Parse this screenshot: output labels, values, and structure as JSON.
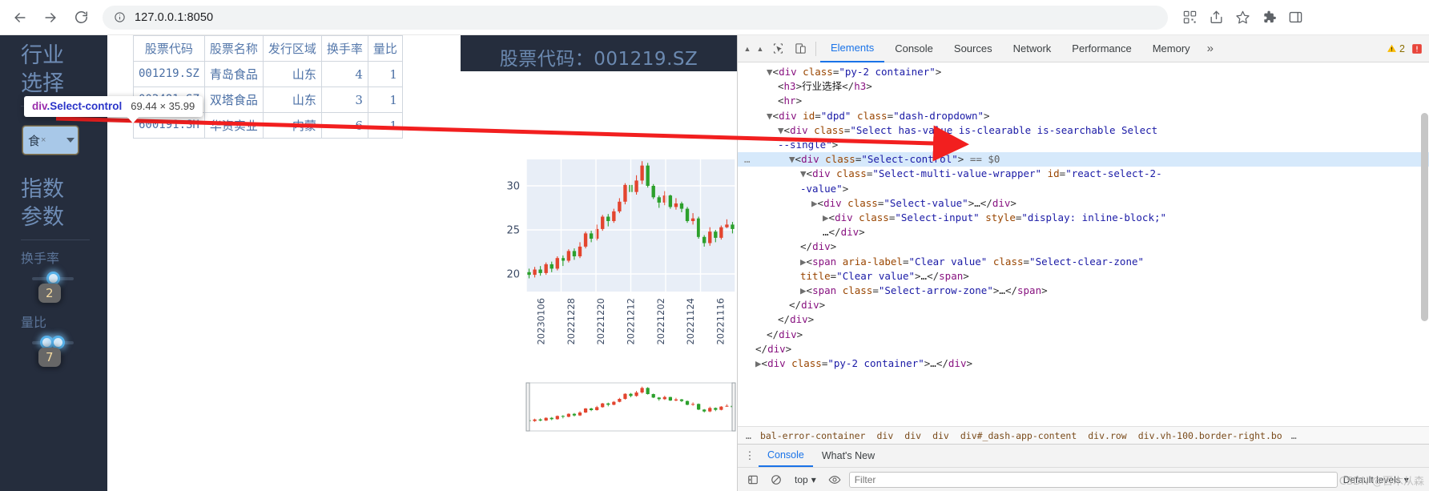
{
  "browser": {
    "url": "127.0.0.1:8050",
    "back_label": "Back",
    "forward_label": "Forward",
    "reload_label": "Reload",
    "site_info_label": "View site information",
    "qr_label": "Create QR code",
    "share_label": "Share this page",
    "bookmark_label": "Bookmark this tab",
    "extensions_label": "Extensions",
    "sidepanel_label": "Side panel"
  },
  "sidebar": {
    "heading_line1": "行业",
    "heading_line2": "选择",
    "dropdown": {
      "value": "食",
      "clear": "×",
      "arrow": "▼"
    },
    "params_line1": "指数",
    "params_line2": "参数",
    "sliders": [
      {
        "label": "换手率",
        "value": "2",
        "pct": 44
      },
      {
        "label": "量比",
        "value": "7",
        "pct": 40
      }
    ]
  },
  "inspect_tooltip": {
    "tag": "div",
    "class": ".Select-control",
    "dimensions": "69.44 × 35.99"
  },
  "table": {
    "columns": [
      "股票代码",
      "股票名称",
      "发行区域",
      "换手率",
      "量比"
    ],
    "rows": [
      [
        "001219.SZ",
        "青岛食品",
        "山东",
        "4",
        "1"
      ],
      [
        "002481.SZ",
        "双塔食品",
        "山东",
        "3",
        "1"
      ],
      [
        "600191.SH",
        "华资实业",
        "内蒙",
        "6",
        "1"
      ]
    ]
  },
  "stock_panel": {
    "title": "股票代码：001219.SZ"
  },
  "chart_data": {
    "type": "candlestick",
    "title": "股票代码：001219.SZ",
    "ylabel": "",
    "xlabel": "",
    "ylim": [
      18,
      33
    ],
    "yticks": [
      20,
      25,
      30
    ],
    "xticks": [
      "20230106",
      "20221228",
      "20221220",
      "20221212",
      "20221202",
      "20221124",
      "20221116"
    ],
    "grid": true,
    "up_color": "#2ca02c",
    "down_color": "#e3452f",
    "series": [
      {
        "date": "20221116",
        "open": 25.1,
        "high": 25.9,
        "low": 24.6,
        "close": 25.6
      },
      {
        "date": "20221117",
        "open": 25.6,
        "high": 26.2,
        "low": 25.2,
        "close": 25.3
      },
      {
        "date": "20221118",
        "open": 25.3,
        "high": 25.5,
        "low": 23.9,
        "close": 24.1
      },
      {
        "date": "20221121",
        "open": 24.1,
        "high": 25.0,
        "low": 23.6,
        "close": 24.8
      },
      {
        "date": "20221122",
        "open": 24.8,
        "high": 25.3,
        "low": 23.2,
        "close": 23.5
      },
      {
        "date": "20221123",
        "open": 23.5,
        "high": 24.4,
        "low": 23.1,
        "close": 24.2
      },
      {
        "date": "20221124",
        "open": 24.2,
        "high": 26.5,
        "low": 24.0,
        "close": 26.3
      },
      {
        "date": "20221125",
        "open": 26.3,
        "high": 26.9,
        "low": 25.6,
        "close": 26.0
      },
      {
        "date": "20221128",
        "open": 26.0,
        "high": 27.6,
        "low": 25.8,
        "close": 27.4
      },
      {
        "date": "20221129",
        "open": 27.4,
        "high": 28.2,
        "low": 27.0,
        "close": 28.0
      },
      {
        "date": "20221130",
        "open": 28.0,
        "high": 28.6,
        "low": 27.3,
        "close": 27.6
      },
      {
        "date": "20221201",
        "open": 27.6,
        "high": 29.0,
        "low": 27.4,
        "close": 28.9
      },
      {
        "date": "20221202",
        "open": 28.9,
        "high": 29.4,
        "low": 27.8,
        "close": 28.1
      },
      {
        "date": "20221205",
        "open": 28.1,
        "high": 28.9,
        "low": 27.5,
        "close": 28.7
      },
      {
        "date": "20221206",
        "open": 28.7,
        "high": 30.2,
        "low": 28.5,
        "close": 30.0
      },
      {
        "date": "20221207",
        "open": 30.0,
        "high": 32.6,
        "low": 29.8,
        "close": 32.3
      },
      {
        "date": "20221208",
        "open": 32.3,
        "high": 32.8,
        "low": 30.2,
        "close": 30.6
      },
      {
        "date": "20221209",
        "open": 30.6,
        "high": 31.2,
        "low": 29.0,
        "close": 29.3
      },
      {
        "date": "20221212",
        "open": 29.3,
        "high": 30.4,
        "low": 28.8,
        "close": 30.1
      },
      {
        "date": "20221213",
        "open": 30.1,
        "high": 30.3,
        "low": 27.9,
        "close": 28.2
      },
      {
        "date": "20221214",
        "open": 28.2,
        "high": 28.6,
        "low": 26.9,
        "close": 27.1
      },
      {
        "date": "20221215",
        "open": 27.1,
        "high": 27.4,
        "low": 25.8,
        "close": 26.0
      },
      {
        "date": "20221216",
        "open": 26.0,
        "high": 26.8,
        "low": 25.4,
        "close": 26.5
      },
      {
        "date": "20221219",
        "open": 26.5,
        "high": 26.7,
        "low": 24.9,
        "close": 25.1
      },
      {
        "date": "20221220",
        "open": 25.1,
        "high": 25.6,
        "low": 23.8,
        "close": 24.0
      },
      {
        "date": "20221221",
        "open": 24.0,
        "high": 24.9,
        "low": 23.6,
        "close": 24.6
      },
      {
        "date": "20221222",
        "open": 24.6,
        "high": 24.8,
        "low": 22.9,
        "close": 23.1
      },
      {
        "date": "20221223",
        "open": 23.1,
        "high": 23.6,
        "low": 21.8,
        "close": 22.0
      },
      {
        "date": "20221226",
        "open": 22.0,
        "high": 22.9,
        "low": 21.6,
        "close": 22.6
      },
      {
        "date": "20221227",
        "open": 22.6,
        "high": 22.8,
        "low": 21.3,
        "close": 21.5
      },
      {
        "date": "20221228",
        "open": 21.5,
        "high": 22.1,
        "low": 20.9,
        "close": 21.8
      },
      {
        "date": "20221229",
        "open": 21.8,
        "high": 22.0,
        "low": 20.4,
        "close": 20.6
      },
      {
        "date": "20221230",
        "open": 20.6,
        "high": 21.4,
        "low": 20.2,
        "close": 21.1
      },
      {
        "date": "20230103",
        "open": 21.1,
        "high": 21.3,
        "low": 19.9,
        "close": 20.1
      },
      {
        "date": "20230104",
        "open": 20.1,
        "high": 20.9,
        "low": 19.8,
        "close": 20.5
      },
      {
        "date": "20230105",
        "open": 20.5,
        "high": 20.8,
        "low": 19.6,
        "close": 19.9
      },
      {
        "date": "20230106",
        "open": 19.9,
        "high": 20.6,
        "low": 19.5,
        "close": 20.2
      }
    ]
  },
  "devtools": {
    "inspect_icon_label": "Inspect element",
    "device_icon_label": "Toggle device toolbar",
    "tabs": [
      {
        "label": "Elements",
        "active": true
      },
      {
        "label": "Console",
        "active": false
      },
      {
        "label": "Sources",
        "active": false
      },
      {
        "label": "Network",
        "active": false
      },
      {
        "label": "Performance",
        "active": false
      },
      {
        "label": "Memory",
        "active": false
      }
    ],
    "more_tabs": "»",
    "warning_count": "2",
    "error_icon": "error",
    "dom_lines": [
      {
        "indent": 2,
        "selected": false,
        "html": "<span class='arrow'>▼</span><span class='punct'>&lt;</span><span class='tag'>div</span> <span class='attr'>class</span><span class='punct'>=</span><span class='val'>\"py-2 container\"</span><span class='punct'>&gt;</span>"
      },
      {
        "indent": 3,
        "selected": false,
        "html": "<span class='punct'>&lt;</span><span class='tag'>h3</span><span class='punct'>&gt;</span><span class='txt'>行业选择</span><span class='punct'>&lt;/</span><span class='tag'>h3</span><span class='punct'>&gt;</span>"
      },
      {
        "indent": 3,
        "selected": false,
        "html": "<span class='punct'>&lt;</span><span class='tag'>hr</span><span class='punct'>&gt;</span>"
      },
      {
        "indent": 2,
        "selected": false,
        "html": "<span class='arrow'>▼</span><span class='punct'>&lt;</span><span class='tag'>div</span> <span class='attr'>id</span><span class='punct'>=</span><span class='val'>\"dpd\"</span> <span class='attr'>class</span><span class='punct'>=</span><span class='val'>\"dash-dropdown\"</span><span class='punct'>&gt;</span>"
      },
      {
        "indent": 3,
        "selected": false,
        "html": "<span class='arrow'>▼</span><span class='punct'>&lt;</span><span class='tag'>div</span> <span class='attr'>class</span><span class='punct'>=</span><span class='val'>\"Select has-value is-clearable is-searchable Select</span>"
      },
      {
        "indent": 3,
        "selected": false,
        "html": "<span class='val'>--single\"</span><span class='punct'>&gt;</span>"
      },
      {
        "indent": 4,
        "selected": true,
        "html": "<span class='arrow'>▼</span><span class='punct'>&lt;</span><span class='tag'>div</span> <span class='attr'>class</span><span class='punct'>=</span><span class='val'>\"Select-control\"</span><span class='punct'>&gt;</span> <span class='eqsel'>== $0</span>"
      },
      {
        "indent": 5,
        "selected": false,
        "html": "<span class='arrow'>▼</span><span class='punct'>&lt;</span><span class='tag'>div</span> <span class='attr'>class</span><span class='punct'>=</span><span class='val'>\"Select-multi-value-wrapper\"</span> <span class='attr'>id</span><span class='punct'>=</span><span class='val'>\"react-select-2-</span>"
      },
      {
        "indent": 5,
        "selected": false,
        "html": "<span class='val'>-value\"</span><span class='punct'>&gt;</span>"
      },
      {
        "indent": 6,
        "selected": false,
        "html": "<span class='arrow'>▶</span><span class='punct'>&lt;</span><span class='tag'>div</span> <span class='attr'>class</span><span class='punct'>=</span><span class='val'>\"Select-value\"</span><span class='punct'>&gt;</span><span class='txt'>…</span><span class='punct'>&lt;/</span><span class='tag'>div</span><span class='punct'>&gt;</span>"
      },
      {
        "indent": 7,
        "selected": false,
        "html": "<span class='arrow'>▶</span><span class='punct'>&lt;</span><span class='tag'>div</span> <span class='attr'>class</span><span class='punct'>=</span><span class='val'>\"Select-input\"</span> <span class='attr'>style</span><span class='punct'>=</span><span class='val'>\"display: inline-block;\"</span>"
      },
      {
        "indent": 7,
        "selected": false,
        "html": "<span class='txt'>…</span><span class='punct'>&lt;/</span><span class='tag'>div</span><span class='punct'>&gt;</span>"
      },
      {
        "indent": 5,
        "selected": false,
        "html": "<span class='punct'>&lt;/</span><span class='tag'>div</span><span class='punct'>&gt;</span>"
      },
      {
        "indent": 5,
        "selected": false,
        "html": "<span class='arrow'>▶</span><span class='punct'>&lt;</span><span class='tag'>span</span> <span class='attr'>aria-label</span><span class='punct'>=</span><span class='val'>\"Clear value\"</span> <span class='attr'>class</span><span class='punct'>=</span><span class='val'>\"Select-clear-zone\"</span>"
      },
      {
        "indent": 5,
        "selected": false,
        "html": "<span class='attr'>title</span><span class='punct'>=</span><span class='val'>\"Clear value\"</span><span class='punct'>&gt;</span><span class='txt'>…</span><span class='punct'>&lt;/</span><span class='tag'>span</span><span class='punct'>&gt;</span>"
      },
      {
        "indent": 5,
        "selected": false,
        "html": "<span class='arrow'>▶</span><span class='punct'>&lt;</span><span class='tag'>span</span> <span class='attr'>class</span><span class='punct'>=</span><span class='val'>\"Select-arrow-zone\"</span><span class='punct'>&gt;</span><span class='txt'>…</span><span class='punct'>&lt;/</span><span class='tag'>span</span><span class='punct'>&gt;</span>"
      },
      {
        "indent": 4,
        "selected": false,
        "html": "<span class='punct'>&lt;/</span><span class='tag'>div</span><span class='punct'>&gt;</span>"
      },
      {
        "indent": 3,
        "selected": false,
        "html": "<span class='punct'>&lt;/</span><span class='tag'>div</span><span class='punct'>&gt;</span>"
      },
      {
        "indent": 2,
        "selected": false,
        "html": "<span class='punct'>&lt;/</span><span class='tag'>div</span><span class='punct'>&gt;</span>"
      },
      {
        "indent": 1,
        "selected": false,
        "html": "<span class='punct'>&lt;/</span><span class='tag'>div</span><span class='punct'>&gt;</span>"
      },
      {
        "indent": 1,
        "selected": false,
        "html": "<span class='arrow'>▶</span><span class='punct'>&lt;</span><span class='tag'>div</span> <span class='attr'>class</span><span class='punct'>=</span><span class='val'>\"py-2 container\"</span><span class='punct'>&gt;</span><span class='txt'>…</span><span class='punct'>&lt;/</span><span class='tag'>div</span><span class='punct'>&gt;</span>"
      }
    ],
    "breadcrumb": [
      "…",
      "bal-error-container",
      "div",
      "div",
      "div",
      "div#_dash-app-content",
      "div.row",
      "div.vh-100.border-right.bo",
      "…"
    ],
    "drawer_tabs": [
      {
        "label": "Console",
        "active": true
      },
      {
        "label": "What's New",
        "active": false
      }
    ],
    "console": {
      "context": "top",
      "filter_placeholder": "Filter",
      "levels": "Default levels",
      "levels_arrow": "▾"
    }
  },
  "watermark": "CSDN @百木从森"
}
